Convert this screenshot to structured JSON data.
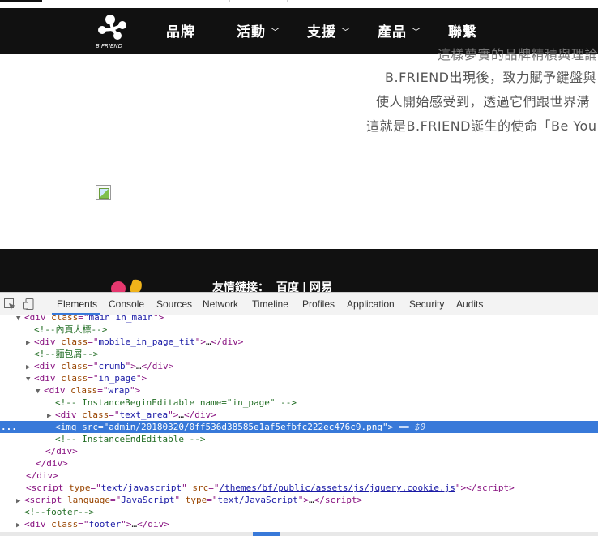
{
  "nav": {
    "items": [
      {
        "label": "品牌",
        "has_dropdown": false
      },
      {
        "label": "活動",
        "has_dropdown": true
      },
      {
        "label": "支援",
        "has_dropdown": true
      },
      {
        "label": "產品",
        "has_dropdown": true
      },
      {
        "label": "聯繫",
        "has_dropdown": false
      }
    ],
    "logo_icon": "bfriend-logo",
    "logo_text": "B.FRIEND"
  },
  "intro_lines": [
    "這樣夢實的品牌精積與理論",
    "B.FRIEND出現後，致力賦予鍵盤與",
    "使人開始感受到，透過它們跟世界溝",
    "這就是B.FRIEND誕生的使命「Be You"
  ],
  "footer": {
    "links_label": "友情鏈接：",
    "link_baidu": "百度",
    "link_divider": "|",
    "link_wangyi": "网易"
  },
  "devtools": {
    "tabs": [
      "Elements",
      "Console",
      "Sources",
      "Network",
      "Timeline",
      "Profiles",
      "Application",
      "Security",
      "Audits"
    ],
    "active_tab": "Elements",
    "tree": {
      "l0": {
        "tag": "div",
        "attr": "class",
        "val": "main in_main"
      },
      "l1": {
        "comment": "內頁大標"
      },
      "l2": {
        "tag": "div",
        "attr": "class",
        "val": "mobile_in_page_tit"
      },
      "l3": {
        "comment": "麵包屑"
      },
      "l4": {
        "tag": "div",
        "attr": "class",
        "val": "crumb"
      },
      "l5": {
        "tag": "div",
        "attr": "class",
        "val": "in_page"
      },
      "l6": {
        "tag": "div",
        "attr": "class",
        "val": "wrap"
      },
      "l7": {
        "comment": " InstanceBeginEditable name=\"in_page\" "
      },
      "l8": {
        "tag": "div",
        "attr": "class",
        "val": "text_area"
      },
      "l9": {
        "tag": "img",
        "attr": "src",
        "val": "admin/20180320/0ff536d38585e1af5efbfc222ec476c9.png",
        "marker": "== $0"
      },
      "l10": {
        "comment": " InstanceEndEditable "
      },
      "l11": {
        "close": "div"
      },
      "l12": {
        "close": "div"
      },
      "l13": {
        "close": "div"
      },
      "l14": {
        "tag": "script",
        "attr": "type",
        "val": "text/javascript",
        "attr2": "src",
        "val2": "/themes/bf/public/assets/js/jquery.cookie.js"
      },
      "l15": {
        "tag": "script",
        "attr": "language",
        "val": "JavaScript",
        "attr2": "type",
        "val2": "text/JavaScript"
      },
      "l16": {
        "comment": "footer"
      },
      "l17": {
        "tag": "div",
        "attr": "class",
        "val": "footer"
      }
    },
    "ellipsis": "…",
    "selected_dots": "..."
  },
  "colors": {
    "nav_bg": "#111111",
    "accent": "#3879d9",
    "tag": "#881280",
    "attr_name": "#994500",
    "attr_value": "#1a1aa6",
    "comment": "#236e25"
  }
}
